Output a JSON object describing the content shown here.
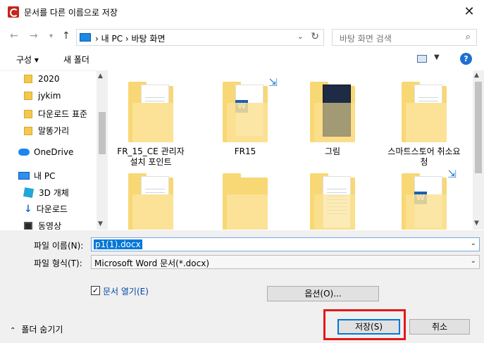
{
  "window": {
    "title": "문서를 다른 이름으로 저장",
    "close_label": "✕"
  },
  "nav": {
    "back_icon": "arrow-left-icon",
    "forward_icon": "arrow-right-icon",
    "recent_icon": "chevron-down-icon",
    "up_icon": "arrow-up-icon",
    "breadcrumb": "›  내 PC  ›  바탕 화면",
    "search_placeholder": "바탕 화면 검색"
  },
  "toolbar": {
    "organize_label": "구성 ▾",
    "new_folder_label": "새 폴더",
    "help_label": "?"
  },
  "sidebar": {
    "items": [
      {
        "label": "2020",
        "icon": "folder-icon"
      },
      {
        "label": "jykim",
        "icon": "folder-icon"
      },
      {
        "label": "다운로드 표준",
        "icon": "folder-icon"
      },
      {
        "label": "말똥가리",
        "icon": "folder-icon"
      },
      {
        "label": "OneDrive",
        "icon": "cloud-icon"
      },
      {
        "label": "내 PC",
        "icon": "computer-icon"
      },
      {
        "label": "3D 개체",
        "icon": "cube-icon"
      },
      {
        "label": "다운로드",
        "icon": "download-icon"
      },
      {
        "label": "동영상",
        "icon": "video-icon"
      }
    ]
  },
  "files": [
    {
      "label": "FR_15_CE 관리자 설치 포인트"
    },
    {
      "label": "FR15"
    },
    {
      "label": "그림"
    },
    {
      "label": "스마트스토어 취소요청"
    },
    {
      "label": ""
    },
    {
      "label": ""
    },
    {
      "label": ""
    },
    {
      "label": ""
    }
  ],
  "form": {
    "filename_label": "파일 이름(N):",
    "filename_value": "p1(1).docx",
    "filetype_label": "파일 형식(T):",
    "filetype_value": "Microsoft Word 문서(*.docx)",
    "open_doc_label": "문서 열기(E)",
    "options_label": "옵션(O)...",
    "save_label": "저장(S)",
    "cancel_label": "취소",
    "hide_folders_label": "폴더 숨기기"
  }
}
